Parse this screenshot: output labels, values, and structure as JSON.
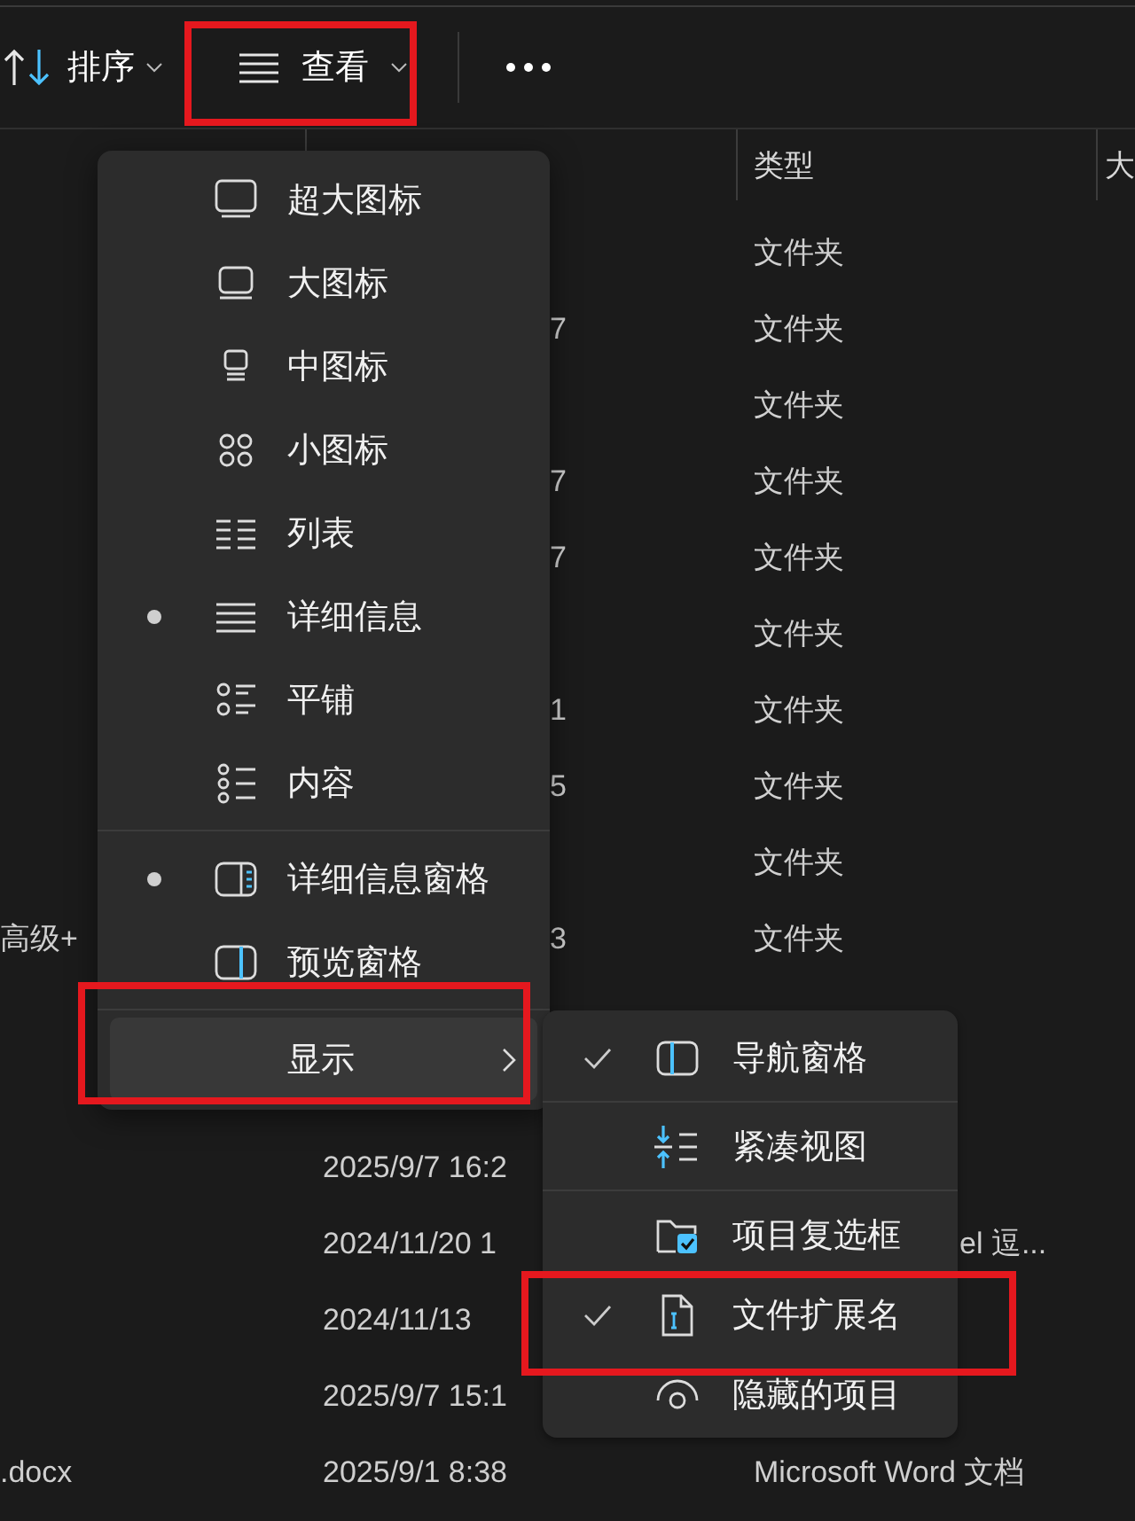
{
  "toolbar": {
    "sort": {
      "label": "排序"
    },
    "view": {
      "label": "查看"
    }
  },
  "table": {
    "columns": [
      {
        "label": "类型"
      },
      {
        "label": "大"
      }
    ],
    "rows_top": [
      {
        "type": "文件夹"
      },
      {
        "date_tail": "7",
        "type": "文件夹"
      },
      {
        "type": "文件夹"
      },
      {
        "date_tail": "7",
        "type": "文件夹"
      },
      {
        "date_tail": "7",
        "type": "文件夹"
      },
      {
        "type": "文件夹"
      },
      {
        "date_tail": "1",
        "type": "文件夹"
      },
      {
        "date_tail": "5",
        "type": "文件夹"
      },
      {
        "type": "文件夹"
      },
      {
        "name": "高级+",
        "date_tail": "3",
        "type": "文件夹"
      }
    ],
    "rows_bottom": [
      {
        "date": "2025/9/7 16:2"
      },
      {
        "date": "2024/11/20 1",
        "type_tail": "el 逗..."
      },
      {
        "date": "2024/11/13"
      },
      {
        "date": "2025/9/7 15:1"
      },
      {
        "name": ".docx",
        "date": "2025/9/1 8:38",
        "type": "Microsoft Word 文档"
      }
    ]
  },
  "view_menu": {
    "sections": [
      [
        {
          "label": "超大图标",
          "selected": false
        },
        {
          "label": "大图标",
          "selected": false
        },
        {
          "label": "中图标",
          "selected": false
        },
        {
          "label": "小图标",
          "selected": false
        },
        {
          "label": "列表",
          "selected": false
        },
        {
          "label": "详细信息",
          "selected": true
        },
        {
          "label": "平铺",
          "selected": false
        },
        {
          "label": "内容",
          "selected": false
        }
      ],
      [
        {
          "label": "详细信息窗格",
          "selected": true
        },
        {
          "label": "预览窗格",
          "selected": false
        }
      ]
    ],
    "show_item": {
      "label": "显示",
      "highlighted": true
    }
  },
  "show_submenu": {
    "sections": [
      [
        {
          "label": "导航窗格",
          "checked": true
        }
      ],
      [
        {
          "label": "紧凑视图",
          "checked": false
        }
      ],
      [
        {
          "label": "项目复选框",
          "checked": false
        },
        {
          "label": "文件扩展名",
          "checked": true
        },
        {
          "label": "隐藏的项目",
          "checked": false
        }
      ]
    ]
  }
}
